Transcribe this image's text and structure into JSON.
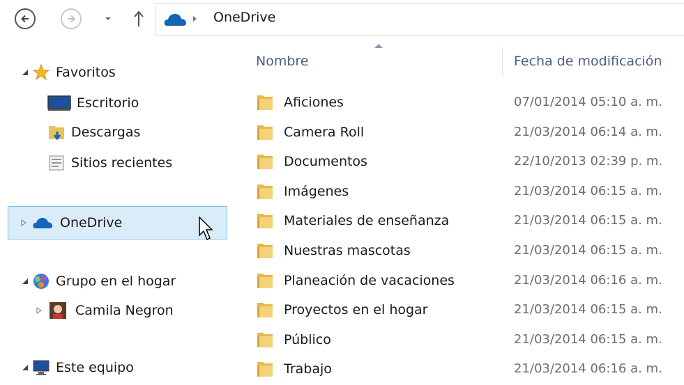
{
  "address": {
    "location": "OneDrive",
    "back_icon": "back-arrow-icon",
    "forward_icon": "forward-arrow-icon",
    "up_icon": "up-arrow-icon"
  },
  "nav": {
    "favorites": {
      "label": "Favoritos",
      "icon": "star-icon"
    },
    "favorites_items": [
      {
        "label": "Escritorio",
        "icon": "desktop-icon"
      },
      {
        "label": "Descargas",
        "icon": "downloads-icon"
      },
      {
        "label": "Sitios recientes",
        "icon": "recent-places-icon"
      }
    ],
    "onedrive": {
      "label": "OneDrive",
      "icon": "onedrive-cloud-icon"
    },
    "homegroup": {
      "label": "Grupo en el hogar",
      "icon": "homegroup-icon"
    },
    "homegroup_user": {
      "label": "Camila Negron",
      "icon": "user-avatar-icon"
    },
    "this_pc": {
      "label": "Este equipo",
      "icon": "computer-icon"
    }
  },
  "columns": {
    "name": "Nombre",
    "date": "Fecha de modificación"
  },
  "files": [
    {
      "name": "Aficiones",
      "date": "07/01/2014 05:10 a. m."
    },
    {
      "name": "Camera Roll",
      "date": "21/03/2014 06:14 a. m."
    },
    {
      "name": "Documentos",
      "date": "22/10/2013 02:39 p. m."
    },
    {
      "name": "Imágenes",
      "date": "21/03/2014 06:15 a. m."
    },
    {
      "name": "Materiales de enseñanza",
      "date": "21/03/2014 06:15 a. m."
    },
    {
      "name": "Nuestras mascotas",
      "date": "21/03/2014 06:15 a. m."
    },
    {
      "name": "Planeación de vacaciones",
      "date": "21/03/2014 06:16 a. m."
    },
    {
      "name": "Proyectos en el hogar",
      "date": "21/03/2014 06:15 a. m."
    },
    {
      "name": "Público",
      "date": "21/03/2014 06:15 a. m."
    },
    {
      "name": "Trabajo",
      "date": "21/03/2014 06:16 a. m."
    }
  ],
  "colors": {
    "selection_bg": "#dbecf9",
    "selection_border": "#7cc1f1",
    "folder": "#e8c25a",
    "header_text": "#4d6082",
    "onedrive_blue": "#1565b7"
  }
}
